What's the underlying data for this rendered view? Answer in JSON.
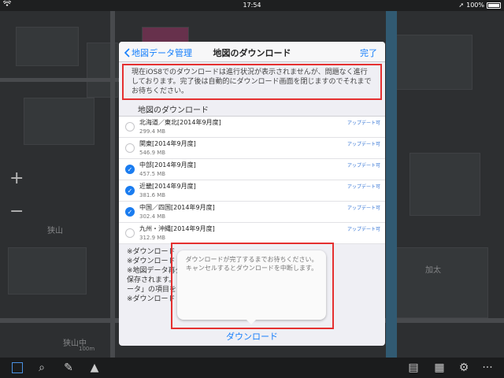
{
  "status_bar": {
    "time": "17:54",
    "battery": "100%",
    "wifi_icon": "wifi-icon"
  },
  "map": {
    "labels": [
      "狭山",
      "加太",
      "狭山中"
    ],
    "zoom_in": "+",
    "zoom_out": "−",
    "scale": "100m"
  },
  "modal": {
    "back_label": "地図データ管理",
    "title": "地図のダウンロード",
    "done_label": "完了",
    "notice": "現在iOS8でのダウンロードは進行状況が表示されませんが、問題なく進行しております。完了後は自動的にダウンロード画面を閉じますのでそれまでお待ちください。",
    "section_title": "地図のダウンロード",
    "items": [
      {
        "name": "北海道／東北[2014年9月度]",
        "size": "299.4 MB",
        "badge": "アップデート可",
        "checked": false
      },
      {
        "name": "関東[2014年9月度]",
        "size": "546.9 MB",
        "badge": "アップデート可",
        "checked": false
      },
      {
        "name": "中部[2014年9月度]",
        "size": "457.5 MB",
        "badge": "アップデート可",
        "checked": true
      },
      {
        "name": "近畿[2014年9月度]",
        "size": "381.6 MB",
        "badge": "アップデート可",
        "checked": true
      },
      {
        "name": "中国／四国[2014年9月度]",
        "size": "302.4 MB",
        "badge": "アップデート可",
        "checked": true
      },
      {
        "name": "九州・沖縄[2014年9月度]",
        "size": "312.9 MB",
        "badge": "アップデート可",
        "checked": false
      }
    ],
    "notes": [
      "※ダウンロード",
      "※ダウンロード",
      "※地図データ再ダ                                    はiCloud上に",
      "保存されます。                                      上「書類とデ",
      "ータ」の項目を",
      "※ダウンロード                                      ます。"
    ],
    "download_label": "ダウンロード"
  },
  "popover": {
    "message": "ダウンロードが完了するまでお待ちください。キャンセルするとダウンロードを中断します。"
  },
  "toolbar": {
    "icons": [
      "select-icon",
      "search-icon",
      "pin-icon",
      "location-arrow-icon",
      "chat-icon",
      "car-icon",
      "settings-icon",
      "more-icon"
    ]
  }
}
